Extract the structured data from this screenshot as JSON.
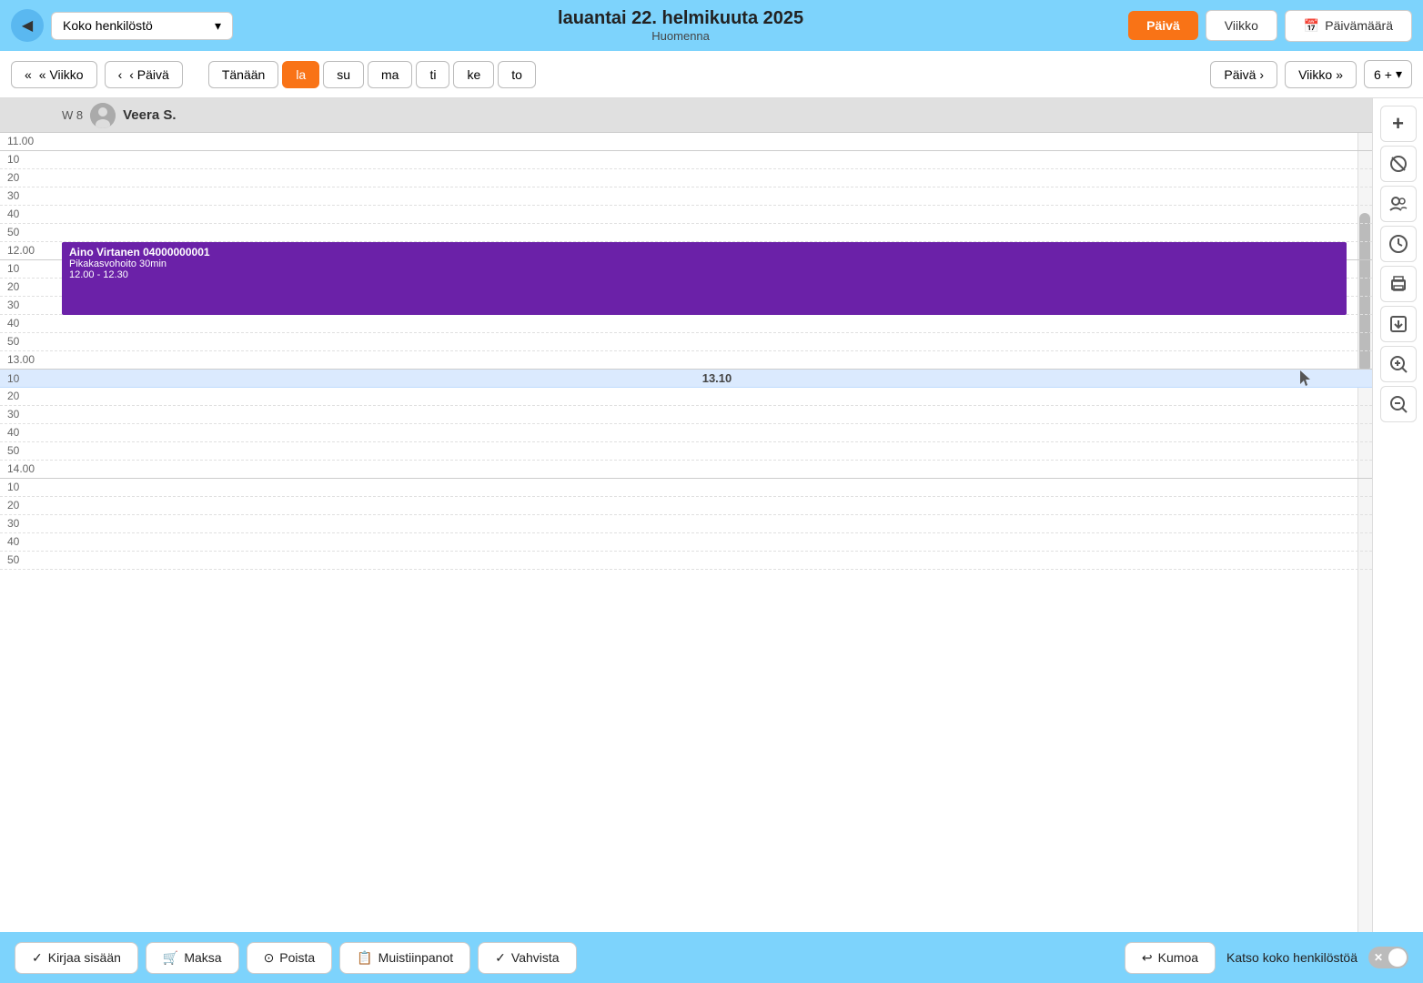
{
  "header": {
    "back_icon": "◀",
    "staff_selector": "Koko henkilöstö",
    "dropdown_icon": "▾",
    "title": "lauantai 22. helmikuuta 2025",
    "subtitle": "Huomenna",
    "btn_paiva": "Päivä",
    "btn_viikko": "Viikko",
    "btn_paivamaara": "Päivämäärä",
    "calendar_icon": "📅"
  },
  "navbar": {
    "btn_viikko_back": "« Viikko",
    "btn_paiva_back": "‹ Päivä",
    "days": [
      {
        "label": "Tänään",
        "active": false
      },
      {
        "label": "la",
        "active": true
      },
      {
        "label": "su",
        "active": false
      },
      {
        "label": "ma",
        "active": false
      },
      {
        "label": "ti",
        "active": false
      },
      {
        "label": "ke",
        "active": false
      },
      {
        "label": "to",
        "active": false
      }
    ],
    "btn_paiva_fwd": "Päivä",
    "btn_viikko_fwd": "Viikko",
    "num": "6",
    "plus_icon": "+"
  },
  "week_header": {
    "week_label": "W 8",
    "person_name": "Veera S."
  },
  "time_rows": [
    {
      "label": "11.00",
      "type": "hour"
    },
    {
      "label": "",
      "type": "sub"
    },
    {
      "label": "",
      "type": "sub"
    },
    {
      "label": "",
      "type": "sub"
    },
    {
      "label": "",
      "type": "sub"
    },
    {
      "label": "",
      "type": "sub"
    },
    {
      "label": "12.00",
      "type": "hour",
      "has_appointment": true
    },
    {
      "label": "",
      "type": "sub"
    },
    {
      "label": "",
      "type": "sub"
    },
    {
      "label": "",
      "type": "sub"
    },
    {
      "label": "",
      "type": "sub"
    },
    {
      "label": "",
      "type": "sub"
    },
    {
      "label": "13.00",
      "type": "hour"
    },
    {
      "label": "",
      "type": "sub",
      "is_indicator": true
    },
    {
      "label": "",
      "type": "sub"
    },
    {
      "label": "",
      "type": "sub"
    },
    {
      "label": "",
      "type": "sub"
    },
    {
      "label": "",
      "type": "sub"
    },
    {
      "label": "14.00",
      "type": "hour"
    },
    {
      "label": "",
      "type": "sub"
    },
    {
      "label": "",
      "type": "sub"
    },
    {
      "label": "",
      "type": "sub"
    },
    {
      "label": "",
      "type": "sub"
    },
    {
      "label": "",
      "type": "sub"
    }
  ],
  "appointment": {
    "name": "Aino Virtanen 04000000001",
    "type": "Pikakasvohoito 30min",
    "time": "12.00 - 12.30"
  },
  "current_time": "13.10",
  "right_sidebar": {
    "icons": [
      {
        "name": "add-icon",
        "symbol": "+"
      },
      {
        "name": "hide-icon",
        "symbol": "🚫"
      },
      {
        "name": "group-icon",
        "symbol": "👥"
      },
      {
        "name": "clock-icon",
        "symbol": "🕐"
      },
      {
        "name": "print-icon",
        "symbol": "🖨"
      },
      {
        "name": "export-icon",
        "symbol": "↪"
      },
      {
        "name": "zoom-in-icon",
        "symbol": "🔍"
      },
      {
        "name": "zoom-out-icon",
        "symbol": "🔍"
      }
    ]
  },
  "bottom_bar": {
    "btn_kirjaa": "Kirjaa sisään",
    "btn_maksa": "Maksa",
    "btn_poista": "Poista",
    "btn_muistiinpanot": "Muistiinpanot",
    "btn_vahvista": "Vahvista",
    "btn_kumoa": "Kumoa",
    "toggle_label": "Katso koko henkilöstöä",
    "check_icon": "✓",
    "cart_icon": "🛒",
    "trash_icon": "⊙",
    "note_icon": "📋",
    "shield_icon": "✓",
    "undo_icon": "↩"
  }
}
